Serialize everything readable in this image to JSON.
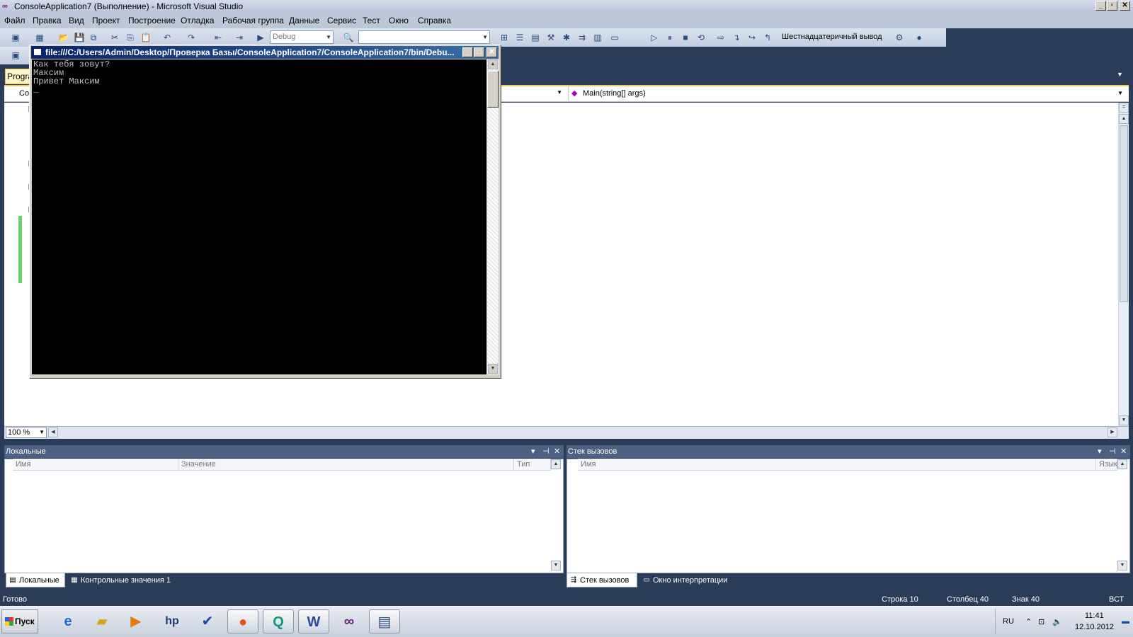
{
  "window": {
    "title": "ConsoleApplication7 (Выполнение) - Microsoft Visual Studio",
    "min": "_",
    "max": "▫",
    "close": "✕"
  },
  "menu": [
    "Файл",
    "Правка",
    "Вид",
    "Проект",
    "Построение",
    "Отладка",
    "Рабочая группа",
    "Данные",
    "Сервис",
    "Тест",
    "Окно",
    "Справка"
  ],
  "toolbar": {
    "config": "Debug",
    "platform": "",
    "hex_label": "Шестнадцатеричный вывод"
  },
  "document": {
    "tab_label": "Progra",
    "nav_left": "Co",
    "nav_right": "Main(string[] args)"
  },
  "zoom": "100 %",
  "console": {
    "title": "file:///C:/Users/Admin/Desktop/Проверка Базы/ConsoleApplication7/ConsoleApplication7/bin/Debu...",
    "lines": [
      "Как тебя зовут?",
      "Максим",
      "Привет Максим",
      "_"
    ]
  },
  "locals": {
    "title": "Локальные",
    "columns": [
      "Имя",
      "Значение",
      "Тип"
    ],
    "tab_locals": "Локальные",
    "tab_watch": "Контрольные значения 1"
  },
  "callstack": {
    "title": "Стек вызовов",
    "columns": [
      "Имя",
      "Язык"
    ],
    "tab_stack": "Стек вызовов",
    "tab_immediate": "Окно интерпретации"
  },
  "status": {
    "ready": "Готово",
    "line": "Строка 10",
    "col": "Столбец 40",
    "char": "Знак 40",
    "mode": "ВСТ"
  },
  "taskbar": {
    "start": "Пуск",
    "lang": "RU",
    "time": "11:41",
    "date": "12.10.2012"
  },
  "icons": [
    "ie-icon",
    "explorer-icon",
    "media-player-icon",
    "hp-icon",
    "tasks-icon",
    "firefox-icon",
    "q-app-icon",
    "word-icon",
    "visual-studio-icon",
    "console-app-icon"
  ]
}
